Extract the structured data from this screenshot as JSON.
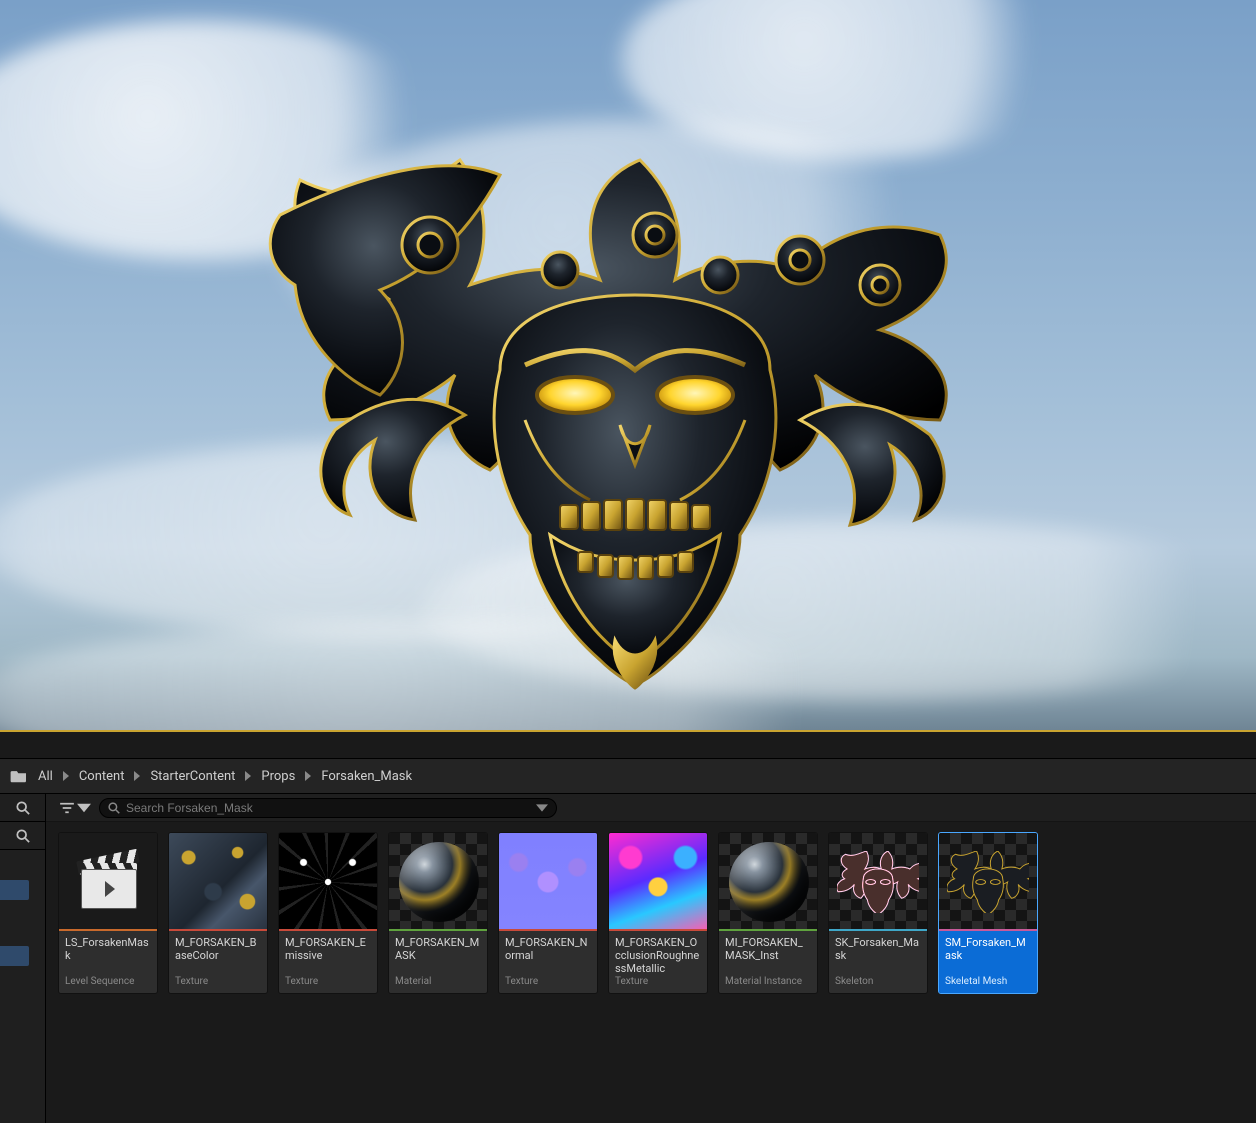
{
  "breadcrumb": {
    "root": "All",
    "items": [
      "Content",
      "StarterContent",
      "Props",
      "Forsaken_Mask"
    ]
  },
  "toolbar": {
    "search_placeholder": "Search Forsaken_Mask"
  },
  "assets": [
    {
      "name": "LS_ForsakenMask",
      "type": "Level Sequence",
      "thumb": "levelseq",
      "strip": "strip-orange",
      "selected": false
    },
    {
      "name": "M_FORSAKEN_BaseColor",
      "type": "Texture",
      "thumb": "basecolor",
      "strip": "strip-red",
      "selected": false
    },
    {
      "name": "M_FORSAKEN_Emissive",
      "type": "Texture",
      "thumb": "emissive",
      "strip": "strip-red",
      "selected": false
    },
    {
      "name": "M_FORSAKEN_MASK",
      "type": "Material",
      "thumb": "matsphere",
      "strip": "strip-green",
      "selected": false
    },
    {
      "name": "M_FORSAKEN_Normal",
      "type": "Texture",
      "thumb": "normal",
      "strip": "strip-red",
      "selected": false
    },
    {
      "name": "M_FORSAKEN_OcclusionRoughnessMetallic",
      "type": "Texture",
      "thumb": "orm",
      "strip": "strip-red",
      "selected": false
    },
    {
      "name": "MI_FORSAKEN_MASK_Inst",
      "type": "Material Instance",
      "thumb": "matsphere",
      "strip": "strip-green",
      "selected": false
    },
    {
      "name": "SK_Forsaken_Mask",
      "type": "Skeleton",
      "thumb": "skel",
      "strip": "strip-cyan",
      "selected": false
    },
    {
      "name": "SM_Forsaken_Mask",
      "type": "Skeletal Mesh",
      "thumb": "mesh",
      "strip": "strip-pink",
      "selected": true
    }
  ],
  "colors": {
    "accent_gold": "#c9a430",
    "accent_blue": "#0b6cd6"
  }
}
